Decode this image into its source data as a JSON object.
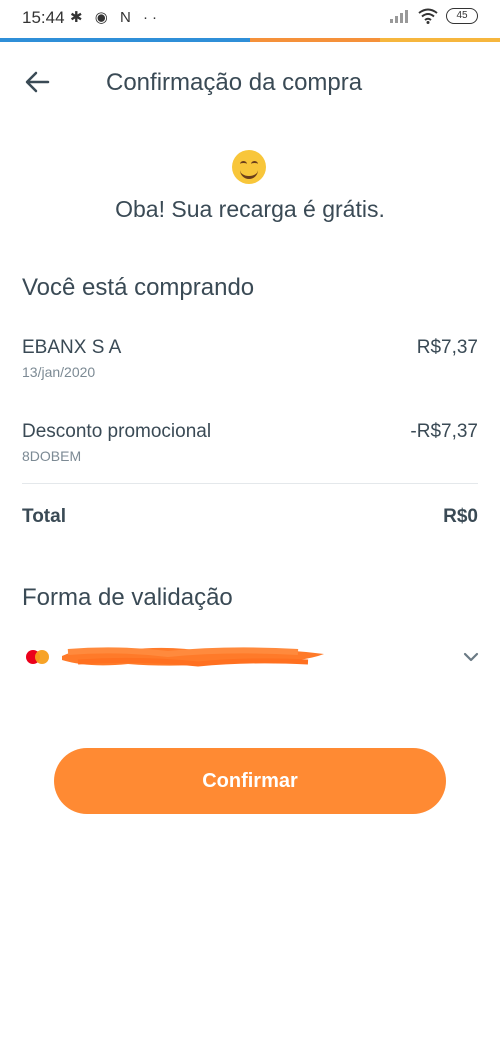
{
  "status_bar": {
    "time": "15:44",
    "left_icons": "✱ ◉ N ··",
    "battery": "45"
  },
  "colors": {
    "accent_orange": "#ff8a33",
    "strip_blue": "#2f8fd8",
    "strip_orange": "#f5913a",
    "strip_yellow": "#f6b63e"
  },
  "header": {
    "title": "Confirmação da compra",
    "back_icon": "arrow-left-icon"
  },
  "hero": {
    "emoji_icon": "smiling-face-icon",
    "message": "Oba! Sua recarga é grátis."
  },
  "purchase": {
    "section_title": "Você está comprando",
    "items": [
      {
        "label": "EBANX S A",
        "sub": "13/jan/2020",
        "value": "R$7,37"
      },
      {
        "label": "Desconto promocional",
        "sub": "8DOBEM",
        "value": "-R$7,37"
      }
    ],
    "total_label": "Total",
    "total_value": "R$0"
  },
  "validation": {
    "section_title": "Forma de validação",
    "card_brand_icon": "mastercard-icon",
    "chevron_icon": "chevron-down-icon"
  },
  "actions": {
    "confirm_label": "Confirmar"
  }
}
